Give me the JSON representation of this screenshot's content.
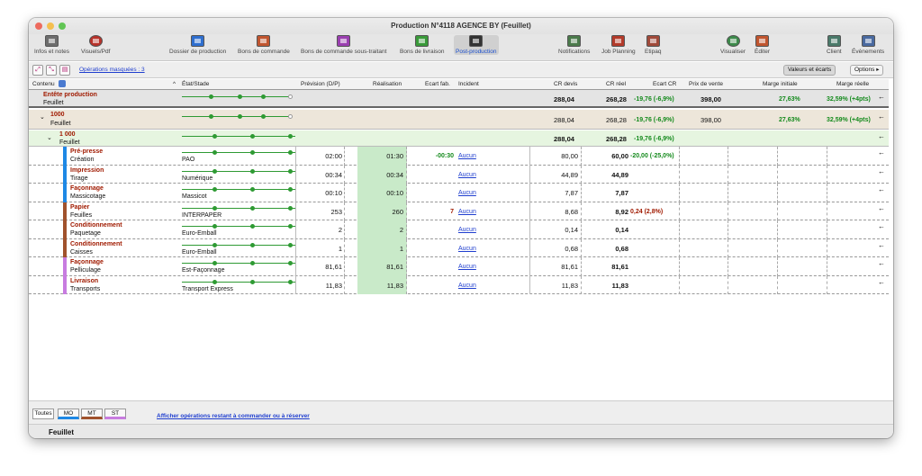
{
  "window": {
    "title": "Production N°4118 AGENCE BY (Feuillet)"
  },
  "toolbar": {
    "left": [
      "Infos et notes",
      "Visuels/Pdf"
    ],
    "center": [
      "Dossier de production",
      "Bons de commande",
      "Bons de commande sous-traitant",
      "Bons de livraison",
      "Post-production"
    ],
    "right": [
      "Notifications",
      "Job Planning",
      "Etipaq",
      "Visualiser",
      "Éditer",
      "Client",
      "Évènements"
    ],
    "active": "Post-production"
  },
  "subbar": {
    "masked_link": "Opérations masquées : 3",
    "valeurs_button": "Valeurs et écarts",
    "options_button": "Options"
  },
  "headers": {
    "contenu": "Contenu",
    "etat": "État/Stade",
    "prevision": "Prévision (D/P)",
    "realisation": "Réalisation",
    "ecart_fab": "Ecart fab.",
    "incident": "Incident",
    "cr_devis": "CR devis",
    "cr_reel": "CR réel",
    "ecart_cr": "Ecart CR",
    "prix": "Prix de vente",
    "marge_init": "Marge initiale",
    "marge_reelle": "Marge réelle"
  },
  "entete": {
    "title": "Entête production",
    "sub": "Feuillet",
    "cr_devis": "288,04",
    "cr_reel": "268,28",
    "ecart_cr": "-19,76 (-6,9%)",
    "prix": "398,00",
    "marge_init": "27,63%",
    "marge_reelle": "32,59% (+4pts)"
  },
  "qty": {
    "title": "1000",
    "sub": "Feuillet",
    "cr_devis": "288,04",
    "cr_reel": "268,28",
    "ecart_cr": "-19,76 (-6,9%)",
    "prix": "398,00",
    "marge_init": "27,63%",
    "marge_reelle": "32,59% (+4pts)"
  },
  "sub1000": {
    "title": "1 000",
    "sub": "Feuillet",
    "cr_devis": "288,04",
    "cr_reel": "268,28",
    "ecart_cr": "-19,76 (-6,9%)"
  },
  "ops": [
    {
      "title": "Pré-presse",
      "sub": "Création",
      "stade": "PAO",
      "prev": "02:00",
      "real": "01:30",
      "ecart": "-00:30",
      "incident": "Aucun",
      "crd": "80,00",
      "crr": "60,00",
      "ecr": "-20,00 (-25,0%)",
      "color": "#1e88e5"
    },
    {
      "title": "Impression",
      "sub": "Tirage",
      "stade": "Numérique",
      "prev": "00:34",
      "real": "00:34",
      "ecart": "",
      "incident": "Aucun",
      "crd": "44,89",
      "crr": "44,89",
      "ecr": "",
      "color": "#1e88e5"
    },
    {
      "title": "Façonnage",
      "sub": "Massicotage",
      "stade": "Massicot",
      "prev": "00:10",
      "real": "00:10",
      "ecart": "",
      "incident": "Aucun",
      "crd": "7,87",
      "crr": "7,87",
      "ecr": "",
      "color": "#1e88e5"
    },
    {
      "title": "Papier",
      "sub": "Feuilles",
      "stade": "INTERPAPER",
      "prev": "253",
      "real": "260",
      "ecart": "7",
      "incident": "Aucun",
      "crd": "8,68",
      "crr": "8,92",
      "ecr": "0,24 (2,8%)",
      "color": "#a0522d"
    },
    {
      "title": "Conditionnement",
      "sub": "Paquetage",
      "stade": "Euro-Emball",
      "prev": "2",
      "real": "2",
      "ecart": "",
      "incident": "Aucun",
      "crd": "0,14",
      "crr": "0,14",
      "ecr": "",
      "color": "#a0522d"
    },
    {
      "title": "Conditionnement",
      "sub": "Caisses",
      "stade": "Euro-Emball",
      "prev": "1",
      "real": "1",
      "ecart": "",
      "incident": "Aucun",
      "crd": "0,68",
      "crr": "0,68",
      "ecr": "",
      "color": "#a0522d"
    },
    {
      "title": "Façonnage",
      "sub": "Pelliculage",
      "stade": "Est-Façonnage",
      "prev": "81,61",
      "real": "81,61",
      "ecart": "",
      "incident": "Aucun",
      "crd": "81,61",
      "crr": "81,61",
      "ecr": "",
      "color": "#c87ce0"
    },
    {
      "title": "Livraison",
      "sub": "Transports",
      "stade": "Transport Express",
      "prev": "11,83",
      "real": "11,83",
      "ecart": "",
      "incident": "Aucun",
      "crd": "11,83",
      "crr": "11,83",
      "ecr": "",
      "color": "#c87ce0"
    }
  ],
  "bottom": {
    "tabs": [
      "Toutes",
      "MO",
      "MT",
      "ST"
    ],
    "link": "Afficher opérations restant à commander ou à réserver"
  },
  "footer": {
    "label": "Feuillet"
  }
}
